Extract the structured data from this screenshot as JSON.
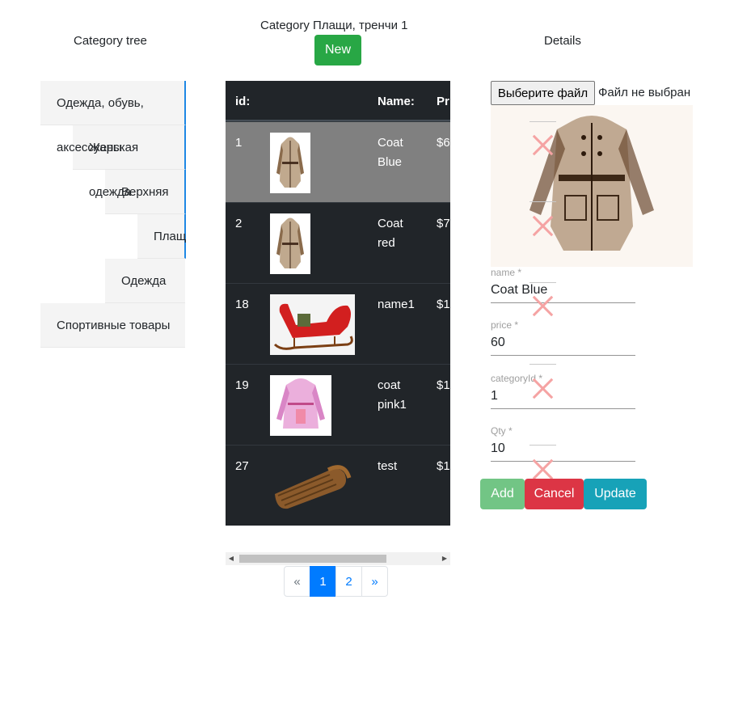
{
  "tree": {
    "title": "Category tree",
    "items": [
      {
        "label": "Одежда, обувь,"
      },
      {
        "label": "аксессуары"
      },
      {
        "label": "Женская"
      },
      {
        "label": "одежда"
      },
      {
        "label": "Верхняя"
      },
      {
        "label": "Плащ"
      },
      {
        "label": "Одежда"
      },
      {
        "label": "Спортивные товары"
      }
    ]
  },
  "category": {
    "title": "Category Плащи, тренчи 1",
    "new_label": "New"
  },
  "table": {
    "headers": {
      "id": "id:",
      "name": "Name:",
      "price": "Pr"
    },
    "rows": [
      {
        "id": "1",
        "name_line1": "Coat",
        "name_line2": "Blue",
        "price": "$6",
        "image": "coat-blue-image"
      },
      {
        "id": "2",
        "name_line1": "Coat",
        "name_line2": "red",
        "price": "$7",
        "image": "coat-red-image"
      },
      {
        "id": "18",
        "name_line1": "name1",
        "name_line2": "",
        "price": "$1",
        "image": "sleigh-image"
      },
      {
        "id": "19",
        "name_line1": "coat",
        "name_line2": "pink1",
        "price": "$1",
        "image": "coat-pink-image"
      },
      {
        "id": "27",
        "name_line1": "test",
        "name_line2": "",
        "price": "$1",
        "image": "wooden-sled-image"
      }
    ]
  },
  "pagination": {
    "prev": "«",
    "pages": [
      "1",
      "2"
    ],
    "active": "1",
    "next": "»"
  },
  "details": {
    "title": "Details",
    "file_button": "Выберите файл",
    "file_status": "Файл не выбран",
    "fields": {
      "name": {
        "label": "name *",
        "value": "Coat Blue"
      },
      "price": {
        "label": "price *",
        "value": "60"
      },
      "categoryId": {
        "label": "categoryId *",
        "value": "1"
      },
      "qty": {
        "label": "Qty *",
        "value": "10"
      }
    },
    "buttons": {
      "add": "Add",
      "cancel": "Cancel",
      "update": "Update"
    }
  },
  "colors": {
    "success": "#28a745",
    "danger": "#dc3545",
    "info": "#17a2b8",
    "primary": "#007bff",
    "table_dark": "#212529",
    "selected_row": "#808080"
  }
}
